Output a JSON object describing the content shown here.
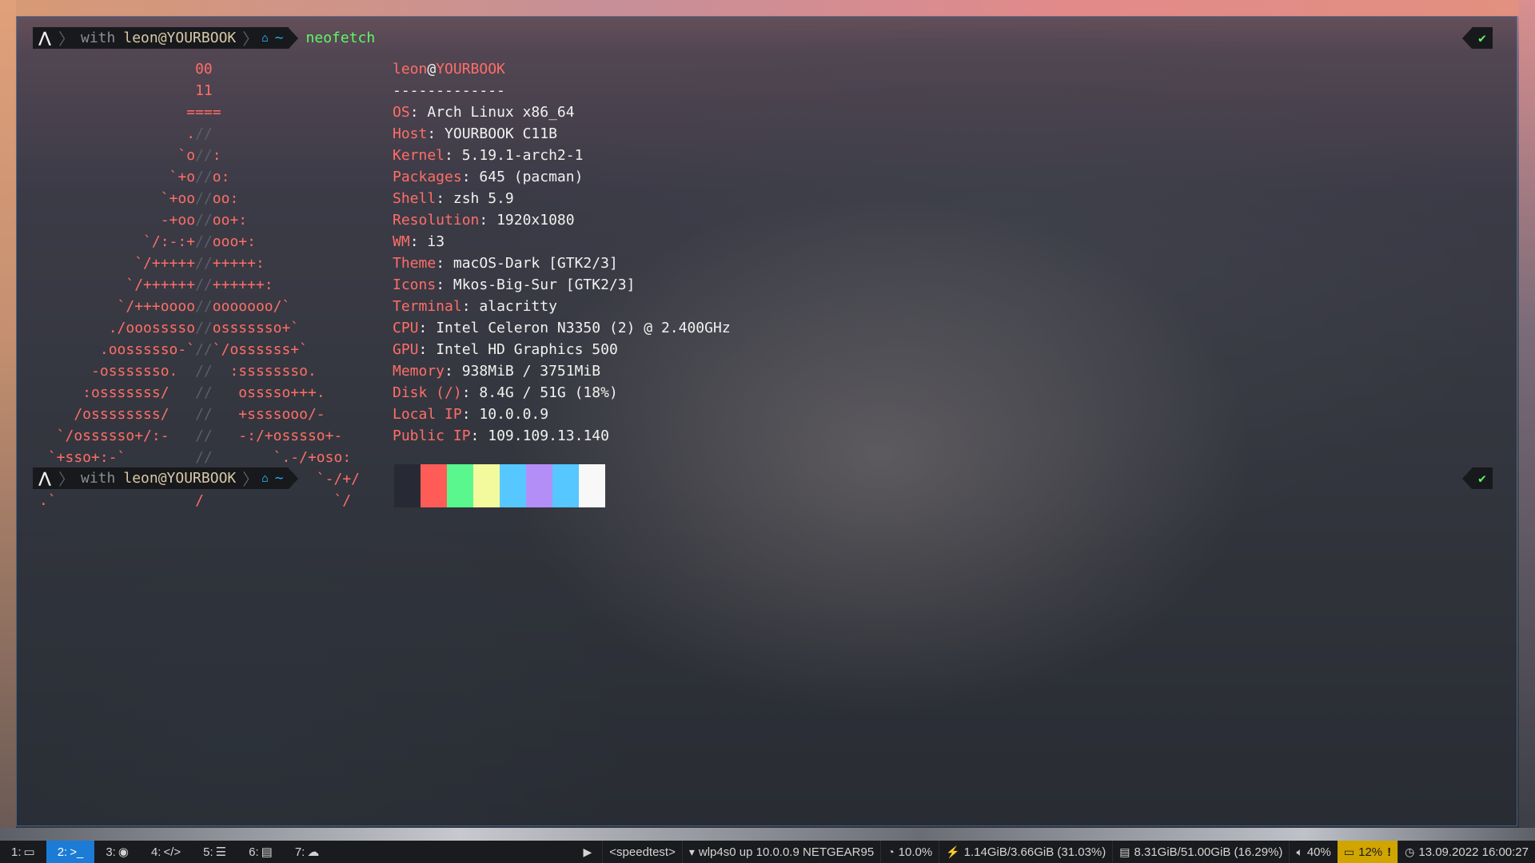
{
  "terminal": {
    "prompt_with": "with",
    "prompt_user": "leon@YOURBOOK",
    "prompt_dir": "~",
    "command": "neofetch",
    "status_ok": "✔"
  },
  "ascii_logo": [
    "                  00",
    "                  11",
    "                 ====",
    "                 .//",
    "                `o//:",
    "               `+o//o:",
    "              `+oo//oo:",
    "              -+oo//oo+:",
    "            `/:-:+//ooo+:",
    "           `/+++++//+++++:",
    "          `/++++++//++++++:",
    "         `/+++oooo//ooooooo/`",
    "        ./ooosssso//osssssso+`",
    "       .oossssso-`//`/ossssss+`",
    "      -osssssso.  //  :ssssssso.",
    "     :osssssss/   //   osssso+++.",
    "    /ossssssss/   //   +ssssooo/-",
    "  `/ossssso+/:-   //   -:/+osssso+-",
    " `+sso+:-`        //       `.-/+oso:",
    "`++:.             //            `-/+/",
    ".`                /               `/"
  ],
  "neofetch": {
    "user": "leon",
    "host": "YOURBOOK",
    "separator": "-------------",
    "fields": [
      {
        "key": "OS",
        "value": "Arch Linux x86_64"
      },
      {
        "key": "Host",
        "value": "YOURBOOK C11B"
      },
      {
        "key": "Kernel",
        "value": "5.19.1-arch2-1"
      },
      {
        "key": "Packages",
        "value": "645 (pacman)"
      },
      {
        "key": "Shell",
        "value": "zsh 5.9"
      },
      {
        "key": "Resolution",
        "value": "1920x1080"
      },
      {
        "key": "WM",
        "value": "i3"
      },
      {
        "key": "Theme",
        "value": "macOS-Dark [GTK2/3]"
      },
      {
        "key": "Icons",
        "value": "Mkos-Big-Sur [GTK2/3]"
      },
      {
        "key": "Terminal",
        "value": "alacritty"
      },
      {
        "key": "CPU",
        "value": "Intel Celeron N3350 (2) @ 2.400GHz"
      },
      {
        "key": "GPU",
        "value": "Intel HD Graphics 500"
      },
      {
        "key": "Memory",
        "value": "938MiB / 3751MiB"
      },
      {
        "key": "Disk (/)",
        "value": "8.4G / 51G (18%)"
      },
      {
        "key": "Local IP",
        "value": "10.0.0.9"
      },
      {
        "key": "Public IP",
        "value": "109.109.13.140"
      }
    ],
    "palette": [
      "#272a34",
      "#ff5c57",
      "#5af78e",
      "#f3f99d",
      "#57c7ff",
      "#b48ef7",
      "#57c7ff",
      "#f8f8f8"
    ]
  },
  "colors": {
    "accent": "#1c7bd6",
    "logo": "#ff6e67",
    "prompt_ok": "#5ff967",
    "warn": "#d0a500"
  },
  "bar": {
    "workspaces": [
      {
        "label": "1:",
        "icon": "monitor-icon",
        "glyph": "▭"
      },
      {
        "label": "2:",
        "icon": "terminal-icon",
        "glyph": ">_",
        "active": true
      },
      {
        "label": "3:",
        "icon": "firefox-icon",
        "glyph": "◉"
      },
      {
        "label": "4:",
        "icon": "code-icon",
        "glyph": "</>"
      },
      {
        "label": "5:",
        "icon": "list-icon",
        "glyph": "☰"
      },
      {
        "label": "6:",
        "icon": "table-icon",
        "glyph": "▤"
      },
      {
        "label": "7:",
        "icon": "cloud-icon",
        "glyph": "☁"
      }
    ],
    "media_icon": "▶",
    "speedtest": "<speedtest>",
    "wifi": "wlp4s0 up 10.0.0.9 NETGEAR95",
    "cpu": "10.0%",
    "memory": "1.14GiB/3.66GiB (31.03%)",
    "disk": "8.31GiB/51.00GiB (16.29%)",
    "volume": "40%",
    "battery": "12%",
    "datetime": "13.09.2022 16:00:27"
  }
}
